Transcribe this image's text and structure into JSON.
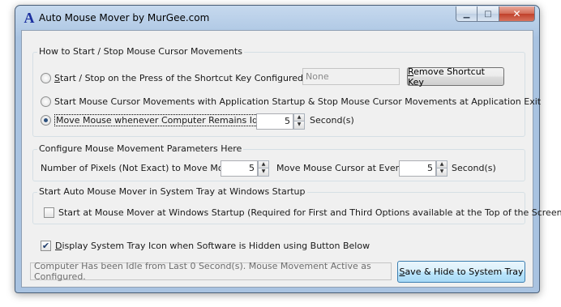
{
  "window": {
    "title": "Auto Mouse Mover by MurGee.com",
    "icon_letter": "A",
    "controls": {
      "minimize": "▁",
      "maximize": "□",
      "close": "✕"
    }
  },
  "start_stop_group": {
    "title": "How to Start / Stop Mouse Cursor Movements",
    "option_shortcut": {
      "label": "Start / Stop on the Press of the Shortcut Key Configured Here :",
      "selected": false
    },
    "shortcut_value": "None",
    "remove_shortcut_button": "Remove Shortcut Key",
    "option_startup": {
      "label": "Start Mouse Cursor Movements with Application Startup & Stop Mouse Cursor Movements at Application Exit",
      "selected": false
    },
    "option_idle": {
      "label": "Move Mouse whenever Computer Remains Idle for",
      "selected": true
    },
    "idle_seconds": "5",
    "idle_unit": "Second(s)"
  },
  "parameters_group": {
    "title": "Configure Mouse Movement Parameters Here",
    "pixels_label": "Number of Pixels (Not Exact) to Move Mouse :",
    "pixels_value": "5",
    "interval_label": "Move Mouse Cursor at Every :",
    "interval_value": "5",
    "interval_unit": "Second(s)"
  },
  "tray_startup_group": {
    "title": "Start Auto Mouse Mover in System Tray at Windows Startup",
    "checkbox_label": "Start at Mouse Mover at Windows Startup (Required for First and Third Options available at the Top of the Screen)",
    "checked": false
  },
  "display_tray_icon": {
    "label": "Display System Tray Icon when Software is Hidden using Button Below",
    "checked": true
  },
  "status_text": "Computer Has been Idle from Last 0 Second(s). Mouse Movement Active as Configured.",
  "save_hide_button": "Save & Hide to System Tray",
  "spinner_arrows": {
    "up": "▲",
    "down": "▼"
  },
  "checkmark": "✔",
  "colors": {
    "title_gradient_top": "#c6d9ee",
    "client_background": "#f0f0f0",
    "close_button": "#c0402a",
    "default_button_border": "#3c7fb1"
  }
}
